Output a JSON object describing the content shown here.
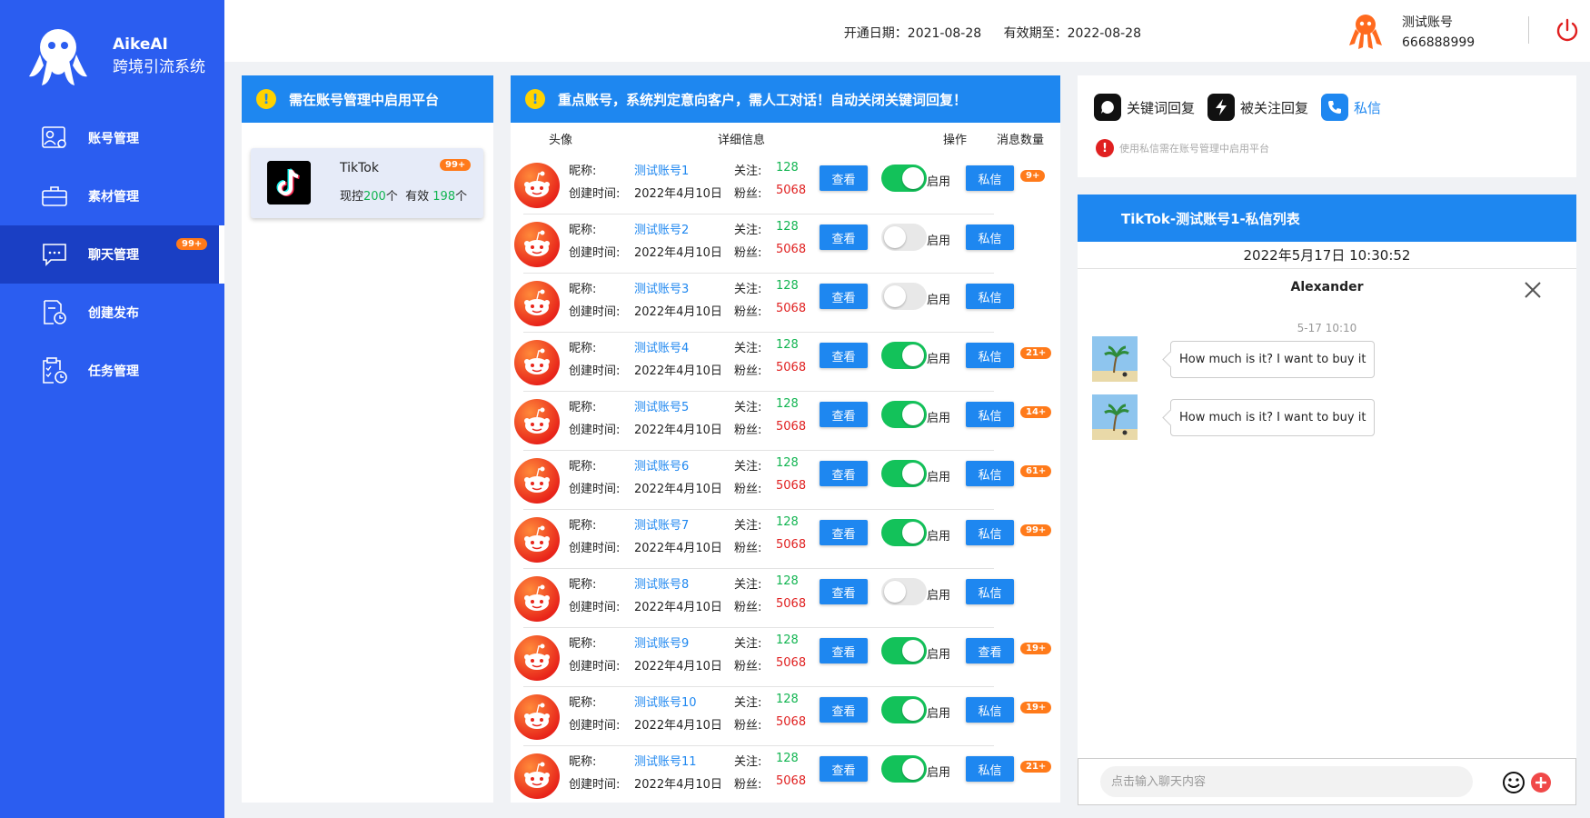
{
  "brand": {
    "name": "AikeAI",
    "subtitle": "跨境引流系统"
  },
  "sidebar": {
    "items": [
      {
        "label": "账号管理",
        "icon": "account-card-icon"
      },
      {
        "label": "素材管理",
        "icon": "briefcase-icon"
      },
      {
        "label": "聊天管理",
        "icon": "chat-bubble-icon",
        "badge": "99+",
        "active": true
      },
      {
        "label": "创建发布",
        "icon": "document-clock-icon"
      },
      {
        "label": "任务管理",
        "icon": "clipboard-clock-icon"
      }
    ]
  },
  "header": {
    "open_date": "开通日期：2021-08-28",
    "valid_until": "有效期至：2022-08-28",
    "user_name": "测试账号",
    "user_id": "666888999"
  },
  "platform_panel": {
    "title": "需在账号管理中启用平台",
    "card": {
      "name": "TikTok",
      "badge": "99+",
      "label_control": "现控",
      "control_count": "200",
      "unit": "个",
      "label_valid": "有效",
      "valid_count": "198"
    }
  },
  "accounts_panel": {
    "title": "重点账号，系统判定意向客户，需人工对话！自动关闭关键词回复！",
    "columns": {
      "avatar": "头像",
      "detail": "详细信息",
      "action": "操作",
      "messages": "消息数量"
    },
    "labels": {
      "nick": "昵称:",
      "created": "创建时间:",
      "follow": "关注:",
      "fans": "粉丝:",
      "view": "查看",
      "enable": "启用"
    },
    "rows": [
      {
        "nick": "测试账号1",
        "created": "2022年4月10日",
        "follow": "128",
        "fans": "5068",
        "enabled": true,
        "action": "私信",
        "badge": "9+"
      },
      {
        "nick": "测试账号2",
        "created": "2022年4月10日",
        "follow": "128",
        "fans": "5068",
        "enabled": false,
        "action": "私信",
        "badge": ""
      },
      {
        "nick": "测试账号3",
        "created": "2022年4月10日",
        "follow": "128",
        "fans": "5068",
        "enabled": false,
        "action": "私信",
        "badge": ""
      },
      {
        "nick": "测试账号4",
        "created": "2022年4月10日",
        "follow": "128",
        "fans": "5068",
        "enabled": true,
        "action": "私信",
        "badge": "21+"
      },
      {
        "nick": "测试账号5",
        "created": "2022年4月10日",
        "follow": "128",
        "fans": "5068",
        "enabled": true,
        "action": "私信",
        "badge": "14+"
      },
      {
        "nick": "测试账号6",
        "created": "2022年4月10日",
        "follow": "128",
        "fans": "5068",
        "enabled": true,
        "action": "私信",
        "badge": "61+"
      },
      {
        "nick": "测试账号7",
        "created": "2022年4月10日",
        "follow": "128",
        "fans": "5068",
        "enabled": true,
        "action": "私信",
        "badge": "99+"
      },
      {
        "nick": "测试账号8",
        "created": "2022年4月10日",
        "follow": "128",
        "fans": "5068",
        "enabled": false,
        "action": "私信",
        "badge": ""
      },
      {
        "nick": "测试账号9",
        "created": "2022年4月10日",
        "follow": "128",
        "fans": "5068",
        "enabled": true,
        "action": "查看",
        "badge": "19+"
      },
      {
        "nick": "测试账号10",
        "created": "2022年4月10日",
        "follow": "128",
        "fans": "5068",
        "enabled": true,
        "action": "私信",
        "badge": "19+"
      },
      {
        "nick": "测试账号11",
        "created": "2022年4月10日",
        "follow": "128",
        "fans": "5068",
        "enabled": true,
        "action": "私信",
        "badge": "21+"
      }
    ]
  },
  "right_panel": {
    "tabs": [
      {
        "label": "关键词回复",
        "icon": "chat-bubble-icon"
      },
      {
        "label": "被关注回复",
        "icon": "lightning-icon"
      },
      {
        "label": "私信",
        "icon": "phone-icon",
        "active": true
      }
    ],
    "notice": "使用私信需在账号管理中启用平台"
  },
  "chat": {
    "title": "TikTok-测试账号1-私信列表",
    "datetime": "2022年5月17日 10:30:52",
    "contact": "Alexander",
    "stamp": "5-17 10:10",
    "messages": [
      {
        "text": "How much is it? I want to buy it"
      },
      {
        "text": "How much is it? I want to buy it"
      }
    ],
    "input_placeholder": "点击输入聊天内容"
  },
  "colors": {
    "sidebar": "#2b5df0",
    "primary": "#1e87f0",
    "badge": "#ff7a1a",
    "green": "#13b552",
    "red": "#e02020"
  }
}
